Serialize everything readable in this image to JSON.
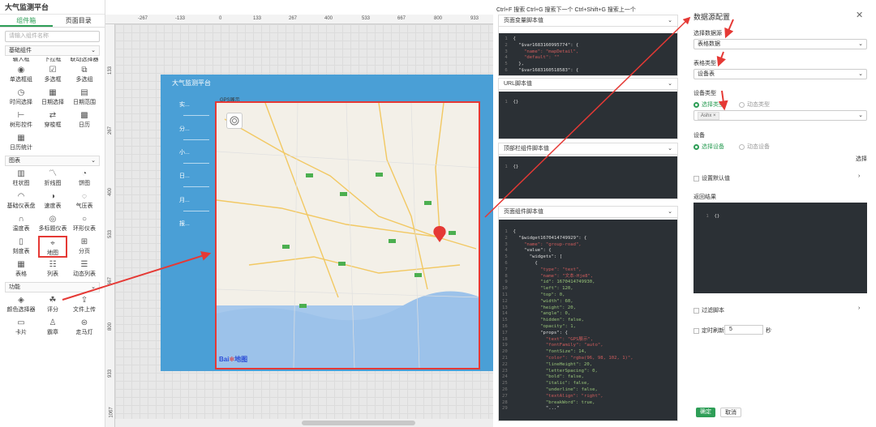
{
  "app": {
    "title": "大气监测平台"
  },
  "left_panel": {
    "tabs": [
      "组件箱",
      "页面目录"
    ],
    "search_placeholder": "请输入组件名称",
    "groups": {
      "basic": {
        "label": "基础组件",
        "cut_labels": [
          "输入框",
          "下拉框",
          "联动选择器"
        ],
        "items": [
          {
            "label": "单选框组",
            "icon": "radio-icon"
          },
          {
            "label": "多选框",
            "icon": "checkbox-icon"
          },
          {
            "label": "多选组",
            "icon": "checkbox-group-icon"
          },
          {
            "label": "时间选择",
            "icon": "clock-icon"
          },
          {
            "label": "日期选择",
            "icon": "calendar-icon"
          },
          {
            "label": "日期范围",
            "icon": "calendar-range-icon"
          },
          {
            "label": "树形控件",
            "icon": "tree-icon"
          },
          {
            "label": "穿梭框",
            "icon": "transfer-icon"
          },
          {
            "label": "日历",
            "icon": "calendar-grid-icon"
          },
          {
            "label": "日历统计",
            "icon": "calendar-stat-icon"
          }
        ]
      },
      "chart": {
        "label": "图表",
        "items": [
          {
            "label": "柱状图",
            "icon": "bar-chart-icon"
          },
          {
            "label": "折线图",
            "icon": "line-chart-icon"
          },
          {
            "label": "饼图",
            "icon": "pie-chart-icon"
          },
          {
            "label": "基础仪表盘",
            "icon": "gauge-icon"
          },
          {
            "label": "速度表",
            "icon": "speedometer-icon"
          },
          {
            "label": "气压表",
            "icon": "barometer-icon"
          },
          {
            "label": "温度表",
            "icon": "thermometer-arc-icon"
          },
          {
            "label": "多标题仪表",
            "icon": "multi-gauge-icon"
          },
          {
            "label": "环形仪表",
            "icon": "ring-gauge-icon"
          },
          {
            "label": "刻度表",
            "icon": "scale-icon"
          },
          {
            "label": "地图",
            "icon": "map-pin-icon"
          },
          {
            "label": "分页",
            "icon": "pagination-icon"
          },
          {
            "label": "表格",
            "icon": "table-icon"
          },
          {
            "label": "列表",
            "icon": "list-icon"
          },
          {
            "label": "动态列表",
            "icon": "dynamic-list-icon"
          }
        ]
      },
      "function": {
        "label": "功能",
        "items": [
          {
            "label": "颜色选择器",
            "icon": "color-picker-icon"
          },
          {
            "label": "评分",
            "icon": "rate-icon"
          },
          {
            "label": "文件上传",
            "icon": "upload-icon"
          },
          {
            "label": "卡片",
            "icon": "card-icon"
          },
          {
            "label": "霸章",
            "icon": "stamp-icon"
          },
          {
            "label": "走马灯",
            "icon": "carousel-icon"
          }
        ]
      }
    }
  },
  "rulers": {
    "top": [
      "-267",
      "-133",
      "0",
      "133",
      "267",
      "400",
      "533",
      "667",
      "800",
      "933"
    ],
    "left": [
      "133",
      "267",
      "400",
      "533",
      "667",
      "800",
      "933",
      "1067"
    ]
  },
  "canvas": {
    "screen_title": "大气监测平台",
    "side_items": [
      "实...",
      "分...",
      "小...",
      "日...",
      "月...",
      "报..."
    ],
    "map_widget_label": "GPS展示",
    "map_logo_text": "Bai",
    "map_logo_suffix": "地图"
  },
  "code_column": {
    "search_tip": "Ctrl+F 搜索 Ctrl+G 搜索下一个 Ctrl+Shift+G 搜索上一个",
    "panels": [
      {
        "title": "页面变量脚本值"
      },
      {
        "title": "URL脚本值"
      },
      {
        "title": "顶部栏组件脚本值"
      },
      {
        "title": "页面组件脚本值"
      }
    ],
    "var_code": [
      [
        "1",
        "{"
      ],
      [
        "2",
        "  \"$var1683160995774\": {"
      ],
      [
        "3",
        "    \"name\": \"mapDetail\","
      ],
      [
        "4",
        "    \"default\": \"\""
      ],
      [
        "5",
        "  },"
      ],
      [
        "6",
        "  \"$var1683160518583\": {"
      ]
    ],
    "url_code": [
      [
        "1",
        "{}"
      ]
    ],
    "top_code": [
      [
        "1",
        "{}"
      ]
    ],
    "page_code": [
      [
        "1",
        "{"
      ],
      [
        "2",
        "  \"$widget1670414749929\": {"
      ],
      [
        "3",
        "    \"name\": \"group-road\","
      ],
      [
        "4",
        "    \"value\": {"
      ],
      [
        "5",
        "      \"widgets\": ["
      ],
      [
        "6",
        "        {"
      ],
      [
        "7",
        "          \"type\": \"text\","
      ],
      [
        "8",
        "          \"name\": \"文本-Hje8\","
      ],
      [
        "9",
        "          \"id\": 1670414749930,"
      ],
      [
        "10",
        "          \"left\": 120,"
      ],
      [
        "11",
        "          \"top\": 0,"
      ],
      [
        "12",
        "          \"width\": 60,"
      ],
      [
        "13",
        "          \"height\": 20,"
      ],
      [
        "14",
        "          \"angle\": 0,"
      ],
      [
        "15",
        "          \"hidden\": false,"
      ],
      [
        "16",
        "          \"opacity\": 1,"
      ],
      [
        "17",
        "          \"props\": {"
      ],
      [
        "18",
        "            \"text\": \"GPS展示\","
      ],
      [
        "19",
        "            \"fontFamily\": \"auto\","
      ],
      [
        "20",
        "            \"fontSize\": 14,"
      ],
      [
        "21",
        "            \"color\": \"rgba(96, 98, 102, 1)\","
      ],
      [
        "22",
        "            \"lineHeight\": 20,"
      ],
      [
        "23",
        "            \"letterSpacing\": 0,"
      ],
      [
        "24",
        "            \"bold\": false,"
      ],
      [
        "25",
        "            \"italic\": false,"
      ],
      [
        "26",
        "            \"underline\": false,"
      ],
      [
        "27",
        "            \"textAlign\": \"right\","
      ],
      [
        "28",
        "            \"breakWord\": true,"
      ],
      [
        "29",
        "            \"...\""
      ]
    ]
  },
  "config": {
    "title": "数据源配置",
    "datasource_label": "选择数据源",
    "datasource_value": "表格数据",
    "table_type_label": "表格类型",
    "table_type_value": "设备表",
    "device_type_label": "设备类型",
    "radio_select_type": "选择类型",
    "radio_dynamic_type": "动态类型",
    "device_type_tag": "Ashx",
    "device_label": "设备",
    "radio_select_device": "选择设备",
    "radio_dynamic_device": "动态设备",
    "select_link": "选择",
    "default_value_label": "设置默认值",
    "return_result_label": "返回结果",
    "result_code": [
      [
        "1",
        "{}"
      ]
    ],
    "filter_script_label": "过滤脚本",
    "refresh_label": "定时刷新",
    "refresh_value": "5",
    "refresh_unit": "秒",
    "ok_button": "确定",
    "cancel_button": "取消"
  },
  "colors": {
    "accent_green": "#2e9e57",
    "highlight_red": "#e53935",
    "screen_blue": "#4a9fd6",
    "editor_bg": "#2b3035"
  }
}
